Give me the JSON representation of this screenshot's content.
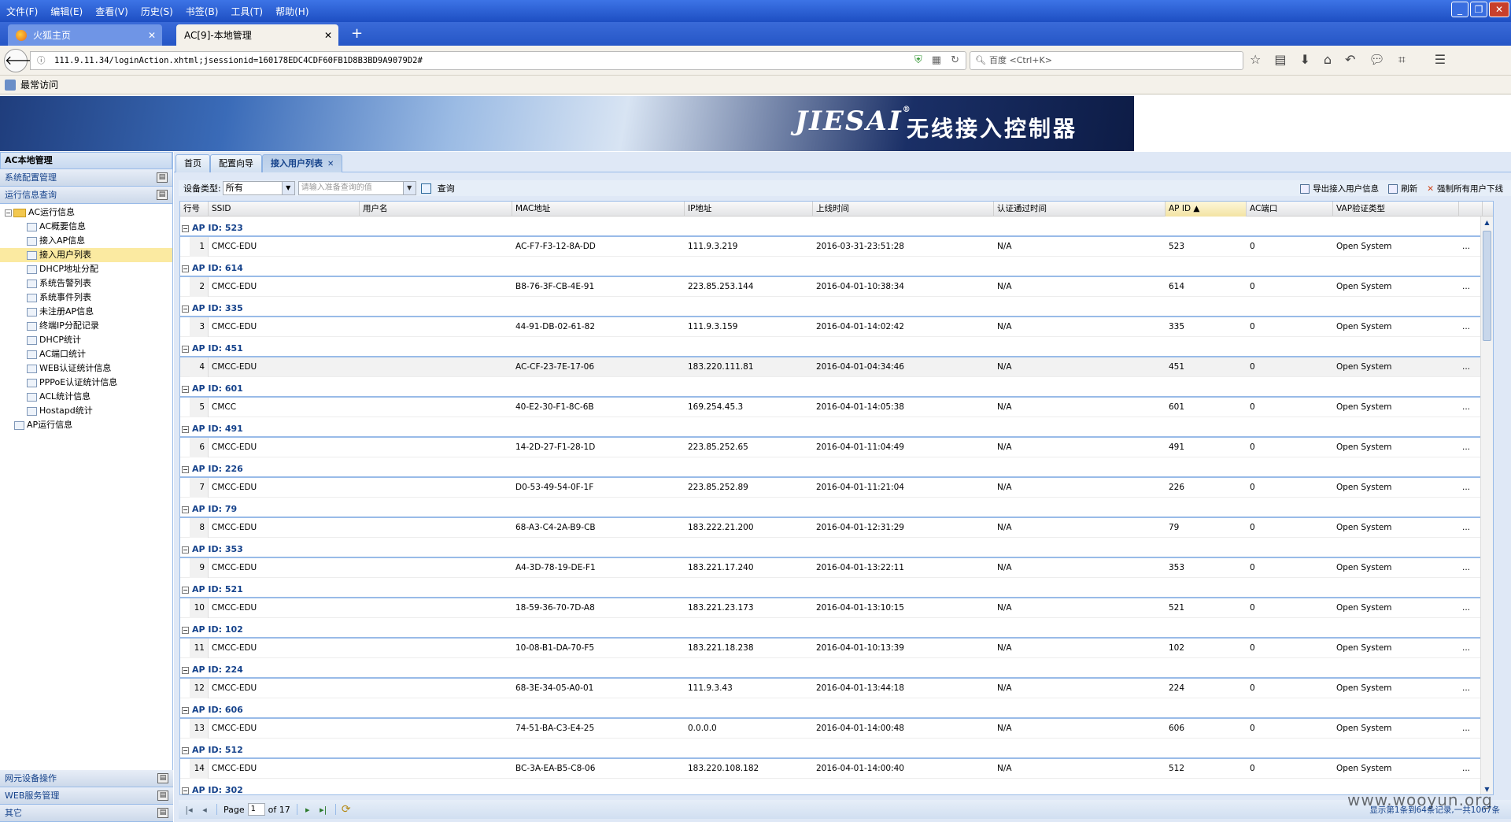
{
  "browser": {
    "menu": [
      "文件(F)",
      "编辑(E)",
      "查看(V)",
      "历史(S)",
      "书签(B)",
      "工具(T)",
      "帮助(H)"
    ],
    "tabs": [
      {
        "label": "火狐主页",
        "active": false
      },
      {
        "label": "AC[9]-本地管理",
        "active": true
      }
    ],
    "new_tab": "+",
    "url": "111.9.11.34/loginAction.xhtml;jsessionid=160178EDC4CDF60FB1D8B3BD9A9079D2#",
    "search_placeholder": "百度 <Ctrl+K>",
    "bookmarks_label": "最常访问",
    "window_buttons": [
      "_",
      "❐",
      "✕"
    ]
  },
  "banner": {
    "brand": "JIESAI",
    "title": "无线接入控制器",
    "colors": {
      "dark": "#1a2f66",
      "light": "#d8e4f3"
    }
  },
  "sidebar": {
    "header": "AC本地管理",
    "sections_top": [
      "系统配置管理",
      "运行信息查询"
    ],
    "tree": [
      {
        "label": "AC运行信息",
        "type": "folder",
        "level": 0
      },
      {
        "label": "AC概要信息",
        "level": 1
      },
      {
        "label": "接入AP信息",
        "level": 1
      },
      {
        "label": "接入用户列表",
        "level": 1,
        "selected": true
      },
      {
        "label": "DHCP地址分配",
        "level": 1
      },
      {
        "label": "系统告警列表",
        "level": 1
      },
      {
        "label": "系统事件列表",
        "level": 1
      },
      {
        "label": "未注册AP信息",
        "level": 1
      },
      {
        "label": "终端IP分配记录",
        "level": 1
      },
      {
        "label": "DHCP统计",
        "level": 1
      },
      {
        "label": "AC端口统计",
        "level": 1
      },
      {
        "label": "WEB认证统计信息",
        "level": 1
      },
      {
        "label": "PPPoE认证统计信息",
        "level": 1
      },
      {
        "label": "ACL统计信息",
        "level": 1
      },
      {
        "label": "Hostapd统计",
        "level": 1
      },
      {
        "label": "AP运行信息",
        "level": 0
      }
    ],
    "sections_bottom": [
      "网元设备操作",
      "WEB服务管理",
      "其它"
    ]
  },
  "main": {
    "tabs": [
      {
        "label": "首页",
        "active": false
      },
      {
        "label": "配置向导",
        "active": false
      },
      {
        "label": "接入用户列表",
        "active": true,
        "closable": true
      }
    ],
    "toolbar": {
      "device_type_label": "设备类型:",
      "device_type_value": "所有",
      "query_placeholder": "请输入准备查询的值",
      "query_button": "查询",
      "export_button": "导出接入用户信息",
      "refresh_button": "刷新",
      "force_offline_button": "强制所有用户下线"
    },
    "grid": {
      "columns": [
        "行号",
        "SSID",
        "用户名",
        "MAC地址",
        "IP地址",
        "上线时间",
        "认证通过时间",
        "AP ID ▲",
        "AC端口",
        "VAP验证类型",
        ""
      ],
      "sorted_column": "AP ID",
      "groups": [
        {
          "label": "AP ID: 523",
          "row": {
            "n": "1",
            "ssid": "CMCC-EDU",
            "user": "",
            "mac": "AC-F7-F3-12-8A-DD",
            "ip": "111.9.3.219",
            "online": "2016-03-31-23:51:28",
            "auth": "N/A",
            "apid": "523",
            "acport": "0",
            "vap": "Open System",
            "more": "..."
          }
        },
        {
          "label": "AP ID: 614",
          "row": {
            "n": "2",
            "ssid": "CMCC-EDU",
            "user": "",
            "mac": "B8-76-3F-CB-4E-91",
            "ip": "223.85.253.144",
            "online": "2016-04-01-10:38:34",
            "auth": "N/A",
            "apid": "614",
            "acport": "0",
            "vap": "Open System",
            "more": "..."
          }
        },
        {
          "label": "AP ID: 335",
          "row": {
            "n": "3",
            "ssid": "CMCC-EDU",
            "user": "",
            "mac": "44-91-DB-02-61-82",
            "ip": "111.9.3.159",
            "online": "2016-04-01-14:02:42",
            "auth": "N/A",
            "apid": "335",
            "acport": "0",
            "vap": "Open System",
            "more": "..."
          }
        },
        {
          "label": "AP ID: 451",
          "row": {
            "n": "4",
            "ssid": "CMCC-EDU",
            "user": "",
            "mac": "AC-CF-23-7E-17-06",
            "ip": "183.220.111.81",
            "online": "2016-04-01-04:34:46",
            "auth": "N/A",
            "apid": "451",
            "acport": "0",
            "vap": "Open System",
            "more": "...",
            "highlight": true
          }
        },
        {
          "label": "AP ID: 601",
          "row": {
            "n": "5",
            "ssid": "CMCC",
            "user": "",
            "mac": "40-E2-30-F1-8C-6B",
            "ip": "169.254.45.3",
            "online": "2016-04-01-14:05:38",
            "auth": "N/A",
            "apid": "601",
            "acport": "0",
            "vap": "Open System",
            "more": "..."
          }
        },
        {
          "label": "AP ID: 491",
          "row": {
            "n": "6",
            "ssid": "CMCC-EDU",
            "user": "",
            "mac": "14-2D-27-F1-28-1D",
            "ip": "223.85.252.65",
            "online": "2016-04-01-11:04:49",
            "auth": "N/A",
            "apid": "491",
            "acport": "0",
            "vap": "Open System",
            "more": "..."
          }
        },
        {
          "label": "AP ID: 226",
          "row": {
            "n": "7",
            "ssid": "CMCC-EDU",
            "user": "",
            "mac": "D0-53-49-54-0F-1F",
            "ip": "223.85.252.89",
            "online": "2016-04-01-11:21:04",
            "auth": "N/A",
            "apid": "226",
            "acport": "0",
            "vap": "Open System",
            "more": "..."
          }
        },
        {
          "label": "AP ID: 79",
          "row": {
            "n": "8",
            "ssid": "CMCC-EDU",
            "user": "",
            "mac": "68-A3-C4-2A-B9-CB",
            "ip": "183.222.21.200",
            "online": "2016-04-01-12:31:29",
            "auth": "N/A",
            "apid": "79",
            "acport": "0",
            "vap": "Open System",
            "more": "..."
          }
        },
        {
          "label": "AP ID: 353",
          "row": {
            "n": "9",
            "ssid": "CMCC-EDU",
            "user": "",
            "mac": "A4-3D-78-19-DE-F1",
            "ip": "183.221.17.240",
            "online": "2016-04-01-13:22:11",
            "auth": "N/A",
            "apid": "353",
            "acport": "0",
            "vap": "Open System",
            "more": "..."
          }
        },
        {
          "label": "AP ID: 521",
          "row": {
            "n": "10",
            "ssid": "CMCC-EDU",
            "user": "",
            "mac": "18-59-36-70-7D-A8",
            "ip": "183.221.23.173",
            "online": "2016-04-01-13:10:15",
            "auth": "N/A",
            "apid": "521",
            "acport": "0",
            "vap": "Open System",
            "more": "..."
          }
        },
        {
          "label": "AP ID: 102",
          "row": {
            "n": "11",
            "ssid": "CMCC-EDU",
            "user": "",
            "mac": "10-08-B1-DA-70-F5",
            "ip": "183.221.18.238",
            "online": "2016-04-01-10:13:39",
            "auth": "N/A",
            "apid": "102",
            "acport": "0",
            "vap": "Open System",
            "more": "..."
          }
        },
        {
          "label": "AP ID: 224",
          "row": {
            "n": "12",
            "ssid": "CMCC-EDU",
            "user": "",
            "mac": "68-3E-34-05-A0-01",
            "ip": "111.9.3.43",
            "online": "2016-04-01-13:44:18",
            "auth": "N/A",
            "apid": "224",
            "acport": "0",
            "vap": "Open System",
            "more": "..."
          }
        },
        {
          "label": "AP ID: 606",
          "row": {
            "n": "13",
            "ssid": "CMCC-EDU",
            "user": "",
            "mac": "74-51-BA-C3-E4-25",
            "ip": "0.0.0.0",
            "online": "2016-04-01-14:00:48",
            "auth": "N/A",
            "apid": "606",
            "acport": "0",
            "vap": "Open System",
            "more": "..."
          }
        },
        {
          "label": "AP ID: 512",
          "row": {
            "n": "14",
            "ssid": "CMCC-EDU",
            "user": "",
            "mac": "BC-3A-EA-B5-C8-06",
            "ip": "183.220.108.182",
            "online": "2016-04-01-14:00:40",
            "auth": "N/A",
            "apid": "512",
            "acport": "0",
            "vap": "Open System",
            "more": "..."
          }
        },
        {
          "label": "AP ID: 302",
          "row": null
        }
      ]
    },
    "pager": {
      "page_label": "Page",
      "page_value": "1",
      "of_label": "of 17",
      "info": "显示第1条到64条记录,一共1067条"
    }
  },
  "watermark": "www.wooyun.org"
}
